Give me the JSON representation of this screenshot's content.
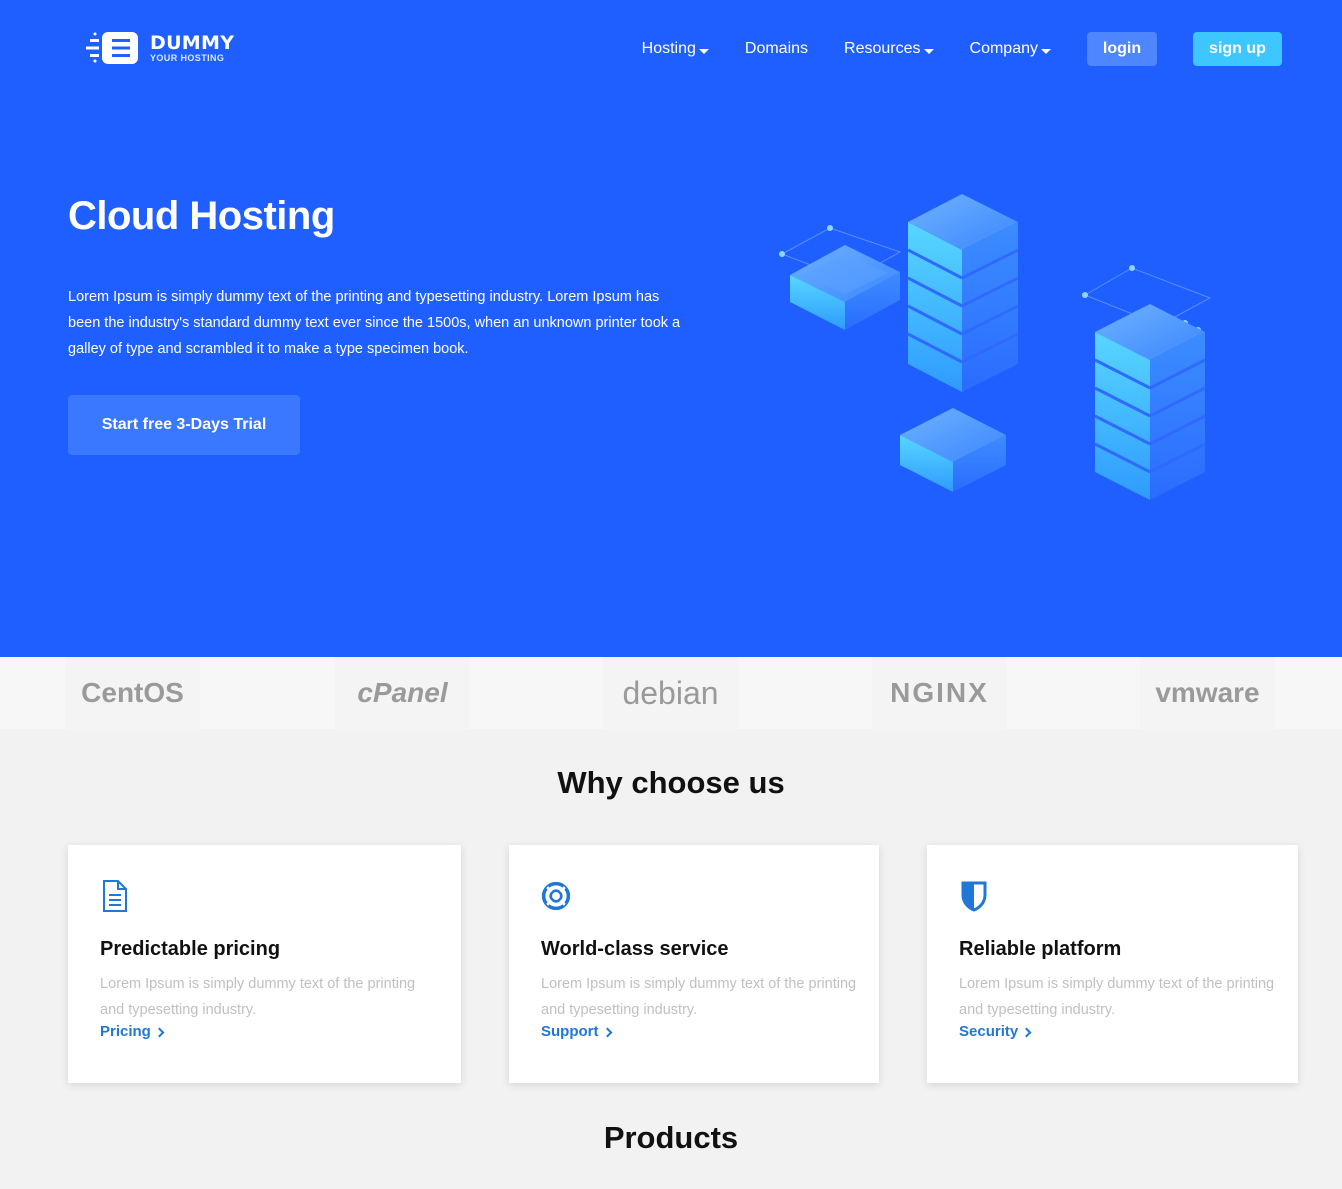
{
  "brand": {
    "name": "DUMMY",
    "tagline": "YOUR HOSTING"
  },
  "nav": {
    "items": [
      {
        "label": "Hosting",
        "dropdown": true
      },
      {
        "label": "Domains",
        "dropdown": false
      },
      {
        "label": "Resources",
        "dropdown": true
      },
      {
        "label": "Company",
        "dropdown": true
      }
    ],
    "login": "login",
    "signup": "sign up"
  },
  "hero": {
    "title": "Cloud Hosting",
    "text": "Lorem Ipsum is simply dummy text of the printing and typesetting industry. Lorem Ipsum has been the industry's standard dummy text ever since the 1500s, when an unknown printer took a galley of type and scrambled it to make a type specimen book.",
    "cta": "Start free 3-Days Trial"
  },
  "partners": [
    "CentOS",
    "cPanel",
    "debian",
    "NGINX",
    "vmware"
  ],
  "why": {
    "title": "Why choose us",
    "cards": [
      {
        "icon": "document-icon",
        "title": "Predictable pricing",
        "text": "Lorem Ipsum is simply dummy text of the printing and typesetting industry.",
        "link": "Pricing"
      },
      {
        "icon": "lifebuoy-icon",
        "title": "World-class service",
        "text": "Lorem Ipsum is simply dummy text of the printing and typesetting industry.",
        "link": "Support"
      },
      {
        "icon": "shield-icon",
        "title": "Reliable platform",
        "text": "Lorem Ipsum is simply dummy text of the printing and typesetting industry.",
        "link": "Security"
      }
    ]
  },
  "products": {
    "title": "Products"
  },
  "colors": {
    "hero_bg": "#1f5eff",
    "accent_link": "#1f77d6",
    "signup_bg": "#3ec6ff",
    "login_bg": "#4d86ff"
  }
}
